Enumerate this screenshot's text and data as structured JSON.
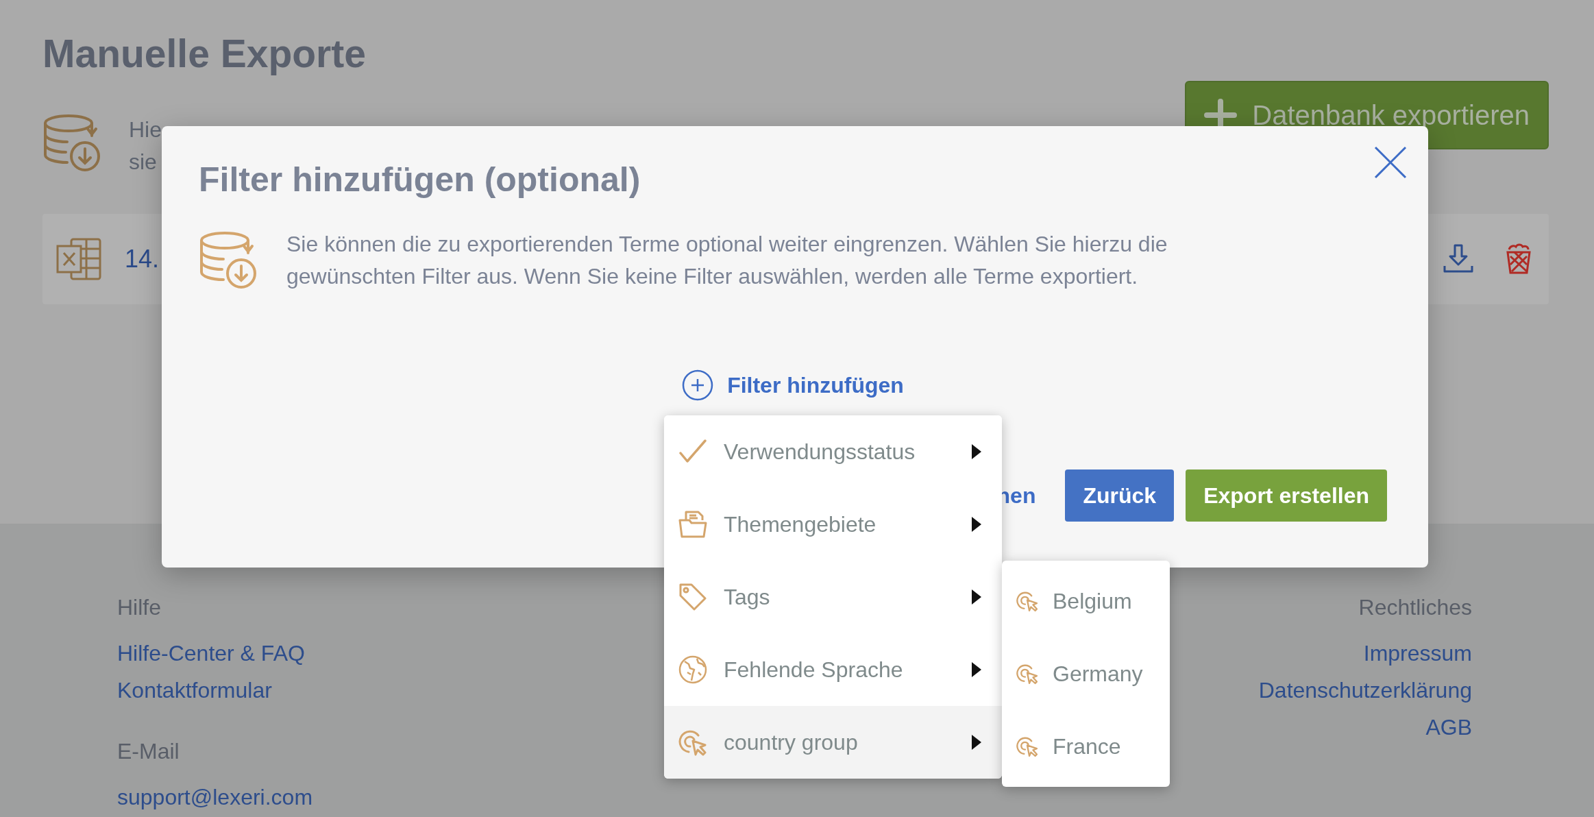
{
  "page": {
    "title": "Manuelle Exporte",
    "intro_lines": [
      "Hie",
      "sie"
    ],
    "export_button": {
      "label": "Datenbank exportieren"
    },
    "export_row": {
      "date": "14."
    }
  },
  "modal": {
    "title": "Filter hinzufügen (optional)",
    "description": "Sie können die zu exportierenden Terme optional weiter eingrenzen. Wählen Sie hierzu die gewünschten Filter aus. Wenn Sie keine Filter auswählen, werden alle Terme exportiert.",
    "add_filter": {
      "label": "Filter hinzufügen"
    },
    "buttons": [
      {
        "label": "nen",
        "kind": "link"
      },
      {
        "label": "Zurück",
        "kind": "primary"
      },
      {
        "label": "Export erstellen",
        "kind": "success"
      }
    ]
  },
  "filter_menu": {
    "items": [
      {
        "label": "Verwendungsstatus",
        "selected": false
      },
      {
        "label": "Themengebiete",
        "selected": false
      },
      {
        "label": "Tags",
        "selected": false
      },
      {
        "label": "Fehlende Sprache",
        "selected": false
      },
      {
        "label": "country group",
        "selected": true
      }
    ],
    "submenu": {
      "items": [
        {
          "label": "Belgium"
        },
        {
          "label": "Germany"
        },
        {
          "label": "France"
        }
      ]
    }
  },
  "footer": {
    "left_sections": [
      {
        "heading": "Hilfe",
        "links": [
          "Hilfe-Center & FAQ",
          "Kontaktformular"
        ]
      },
      {
        "heading": "E-Mail",
        "links": [
          "support@lexeri.com"
        ]
      }
    ],
    "right_sections": [
      {
        "heading": "Rechtliches",
        "links": [
          "Impressum",
          "Datenschutzerklärung",
          "AGB"
        ]
      }
    ]
  }
}
